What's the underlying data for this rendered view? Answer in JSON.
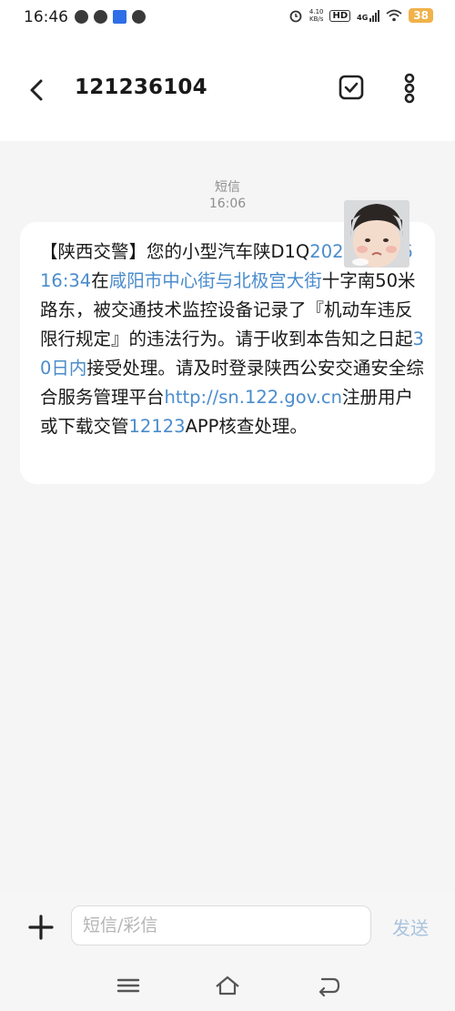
{
  "status_bar": {
    "time": "16:46",
    "net_speed_value": "4.10",
    "net_speed_unit": "KB/s",
    "hd_badge": "HD",
    "network": "4G",
    "battery": "38",
    "left_icons": [
      "app-icon-1",
      "message-bubble-icon",
      "news-app-icon",
      "wechat-icon"
    ],
    "right_icons": [
      "alarm-icon",
      "hd-icon",
      "signal-icon",
      "wifi-icon",
      "battery-icon"
    ]
  },
  "header": {
    "title": "121236104",
    "back_icon": "back-arrow-icon",
    "select_icon": "checkbox-icon",
    "more_icon": "more-vertical-icon"
  },
  "conversation": {
    "type_label": "短信",
    "time_label": "16:06",
    "message": {
      "segments": [
        {
          "text": "【陕西交警】您的小型汽车陕D1Q",
          "link": false
        },
        {
          "text": "2023-07-26 16:34",
          "link": true
        },
        {
          "text": "在",
          "link": false
        },
        {
          "text": "咸阳市中心街与北极宫大街",
          "link": true
        },
        {
          "text": "十字南50米路东，被交通技术监控设备记录了『机动车违反限行规定』的违法行为。请于收到本告知之日起",
          "link": false
        },
        {
          "text": "30日内",
          "link": true
        },
        {
          "text": "接受处理。请及时登录陕西公安交通安全综合服务管理平台",
          "link": false
        },
        {
          "text": "http://sn.122.gov.cn",
          "link": true
        },
        {
          "text": "注册用户或下载交管",
          "link": false
        },
        {
          "text": "12123",
          "link": true
        },
        {
          "text": "APP核查处理。",
          "link": false
        }
      ],
      "link_color": "#4a8ccc"
    }
  },
  "composer": {
    "placeholder": "短信/彩信",
    "value": "",
    "send_label": "发送",
    "plus_icon": "plus-icon"
  },
  "nav_bar": {
    "icons": [
      "menu-icon",
      "home-icon",
      "back-icon"
    ]
  },
  "colors": {
    "background": "#f5f5f5",
    "bubble": "#ffffff",
    "link": "#4a8ccc",
    "send_disabled": "#a8c3de",
    "battery": "#f0b24a"
  }
}
